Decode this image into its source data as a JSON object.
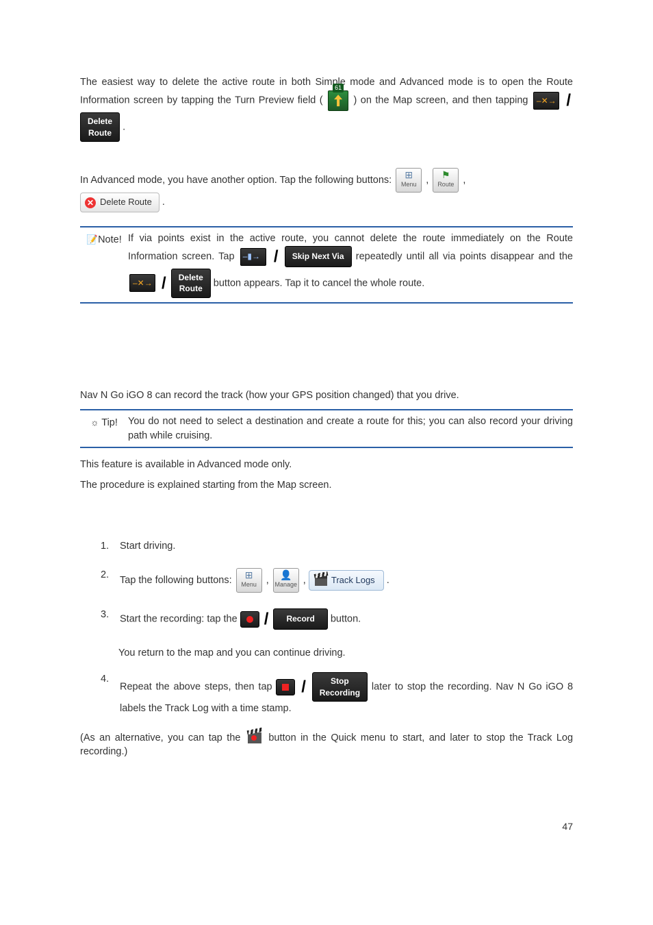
{
  "section_delete": {
    "p1_a": "The easiest way to delete the active route in both Simple mode and Advanced mode is to open the Route Information screen by tapping the Turn Preview field (",
    "p1_b": ") on the Map screen, and then tapping ",
    "delete_route_chip_l1": "Delete",
    "delete_route_chip_l2": "Route",
    "p2_a": "In Advanced mode, you have another option. Tap the following buttons: ",
    "menu_btn_label": "Menu",
    "route_btn_label": "Route",
    "pill_delete_route": "Delete Route"
  },
  "note": {
    "label": "Note!",
    "line1_a": "If via points exist in the active route, you cannot delete the route immediately on the Route Information screen. Tap ",
    "skip_next_via": "Skip Next Via",
    "line1_b": " repeatedly until all via points disappear and the ",
    "delete_route_chip_l1": "Delete",
    "delete_route_chip_l2": "Route",
    "line1_c": " button appears. Tap it to cancel the whole route."
  },
  "section_record": {
    "intro": "Nav N Go iGO 8 can record the track (how your GPS position changed) that you drive.",
    "tip_label": "Tip!",
    "tip_body": "You do not need to select a destination and create a route for this; you can also record your driving path while cruising.",
    "avail": "This feature is available in Advanced mode only.",
    "procedure": "The procedure is explained starting from the Map screen."
  },
  "steps": {
    "s1": "Start driving.",
    "s2": "Tap the following buttons: ",
    "menu_btn_label": "Menu",
    "manage_btn_label": "Manage",
    "track_logs_label": "Track Logs",
    "s3_a": "Start the recording: tap the ",
    "record_chip": "Record",
    "s3_b": " button.",
    "s3_return": "You return to the map and you can continue driving.",
    "s4_a": "Repeat the above steps, then tap ",
    "stop_l1": "Stop",
    "stop_l2": "Recording",
    "s4_b": " later to stop the recording. Nav N Go iGO 8 labels the Track Log with a time stamp."
  },
  "alt": {
    "a": "(As an alternative, you can tap the ",
    "b": " button in the Quick menu to start, and later to stop the Track Log recording.)"
  },
  "page_number": "47"
}
